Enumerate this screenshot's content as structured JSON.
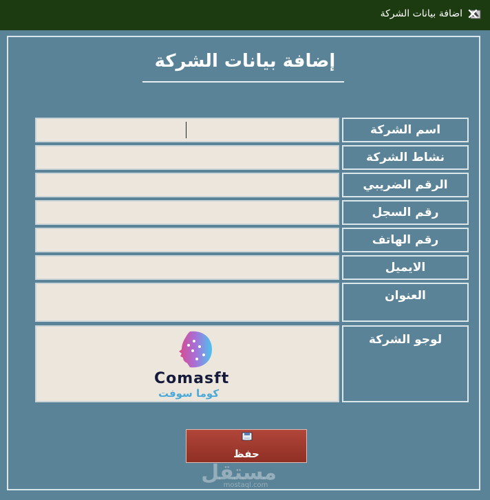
{
  "window": {
    "title": "اضافة بيانات الشركة",
    "close_label": "✕"
  },
  "header": {
    "title": "إضافة بيانات الشركة"
  },
  "form": {
    "fields": [
      {
        "label": "اسم الشركة",
        "value": ""
      },
      {
        "label": "نشاط الشركة",
        "value": ""
      },
      {
        "label": "الرقم الضريبي",
        "value": ""
      },
      {
        "label": "رقم السجل",
        "value": ""
      },
      {
        "label": "رقم الهاتف",
        "value": ""
      },
      {
        "label": "الايميل",
        "value": ""
      },
      {
        "label": "العنوان",
        "value": ""
      }
    ],
    "logo_label": "لوجو الشركة"
  },
  "logo": {
    "brand": "Comasft",
    "brand_arabic": "كوما سوفت"
  },
  "actions": {
    "save_label": "حفظ"
  },
  "watermark": {
    "text": "مستقل",
    "sub": "mostaql.com"
  },
  "colors": {
    "titlebar": "#1c3b10",
    "background": "#5b8397",
    "input_bg": "#ede6dc",
    "save_button": "#a13d31"
  }
}
